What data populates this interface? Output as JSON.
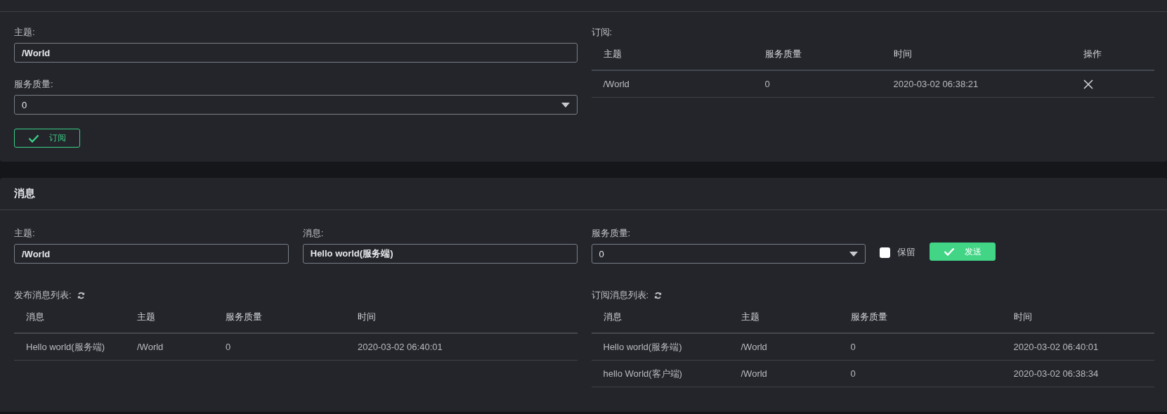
{
  "subscribe_panel": {
    "topic": {
      "label": "主题:",
      "value": "/World"
    },
    "qos": {
      "label": "服务质量:",
      "value": "0"
    },
    "subscribe_button": {
      "label": "订阅"
    },
    "subscriptions": {
      "label": "订阅:",
      "columns": [
        "主题",
        "服务质量",
        "时间",
        "操作"
      ],
      "rows": [
        {
          "cells": [
            "/World",
            "0",
            "2020-03-02 06:38:21"
          ]
        }
      ]
    }
  },
  "message_panel": {
    "title": "消息",
    "topic": {
      "label": "主题:",
      "value": "/World"
    },
    "message": {
      "label": "消息:",
      "value": "Hello world(服务端)"
    },
    "qos": {
      "label": "服务质量:",
      "value": "0"
    },
    "retain": {
      "label": "保留",
      "checked": false
    },
    "send_button": {
      "label": "发送"
    },
    "published": {
      "label": "发布消息列表:",
      "columns": [
        "消息",
        "主题",
        "服务质量",
        "时间"
      ],
      "rows": [
        {
          "cells": [
            "Hello world(服务端)",
            "/World",
            "0",
            "2020-03-02 06:40:01"
          ]
        }
      ]
    },
    "received": {
      "label": "订阅消息列表:",
      "columns": [
        "消息",
        "主题",
        "服务质量",
        "时间"
      ],
      "rows": [
        {
          "cells": [
            "Hello world(服务端)",
            "/World",
            "0",
            "2020-03-02 06:40:01"
          ]
        },
        {
          "cells": [
            "hello World(客户端)",
            "/World",
            "0",
            "2020-03-02 06:38:34"
          ]
        }
      ]
    }
  }
}
